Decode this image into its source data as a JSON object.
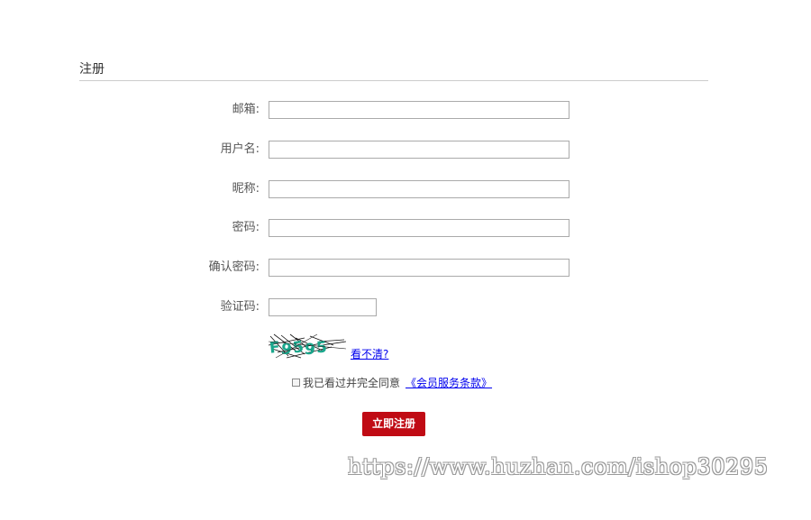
{
  "section": {
    "title": "注册"
  },
  "form": {
    "fields": [
      {
        "label": "邮箱:",
        "value": "",
        "placeholder": ""
      },
      {
        "label": "用户名:",
        "value": "",
        "placeholder": ""
      },
      {
        "label": "昵称:",
        "value": "",
        "placeholder": ""
      },
      {
        "label": "密码:",
        "value": "",
        "placeholder": ""
      },
      {
        "label": "确认密码:",
        "value": "",
        "placeholder": ""
      },
      {
        "label": "验证码:",
        "value": "",
        "placeholder": ""
      }
    ],
    "captcha": {
      "refresh_label": "看不清?"
    },
    "agreement": {
      "text": "我已看过并完全同意",
      "link_label": "《会员服务条款》",
      "checked": false
    },
    "submit_label": "立即注册"
  },
  "watermark": "https://www.huzhan.com/ishop30295",
  "colors": {
    "submit_button": "#c00b14",
    "link": "#0000ee",
    "captcha_text": "#1aa78c"
  }
}
